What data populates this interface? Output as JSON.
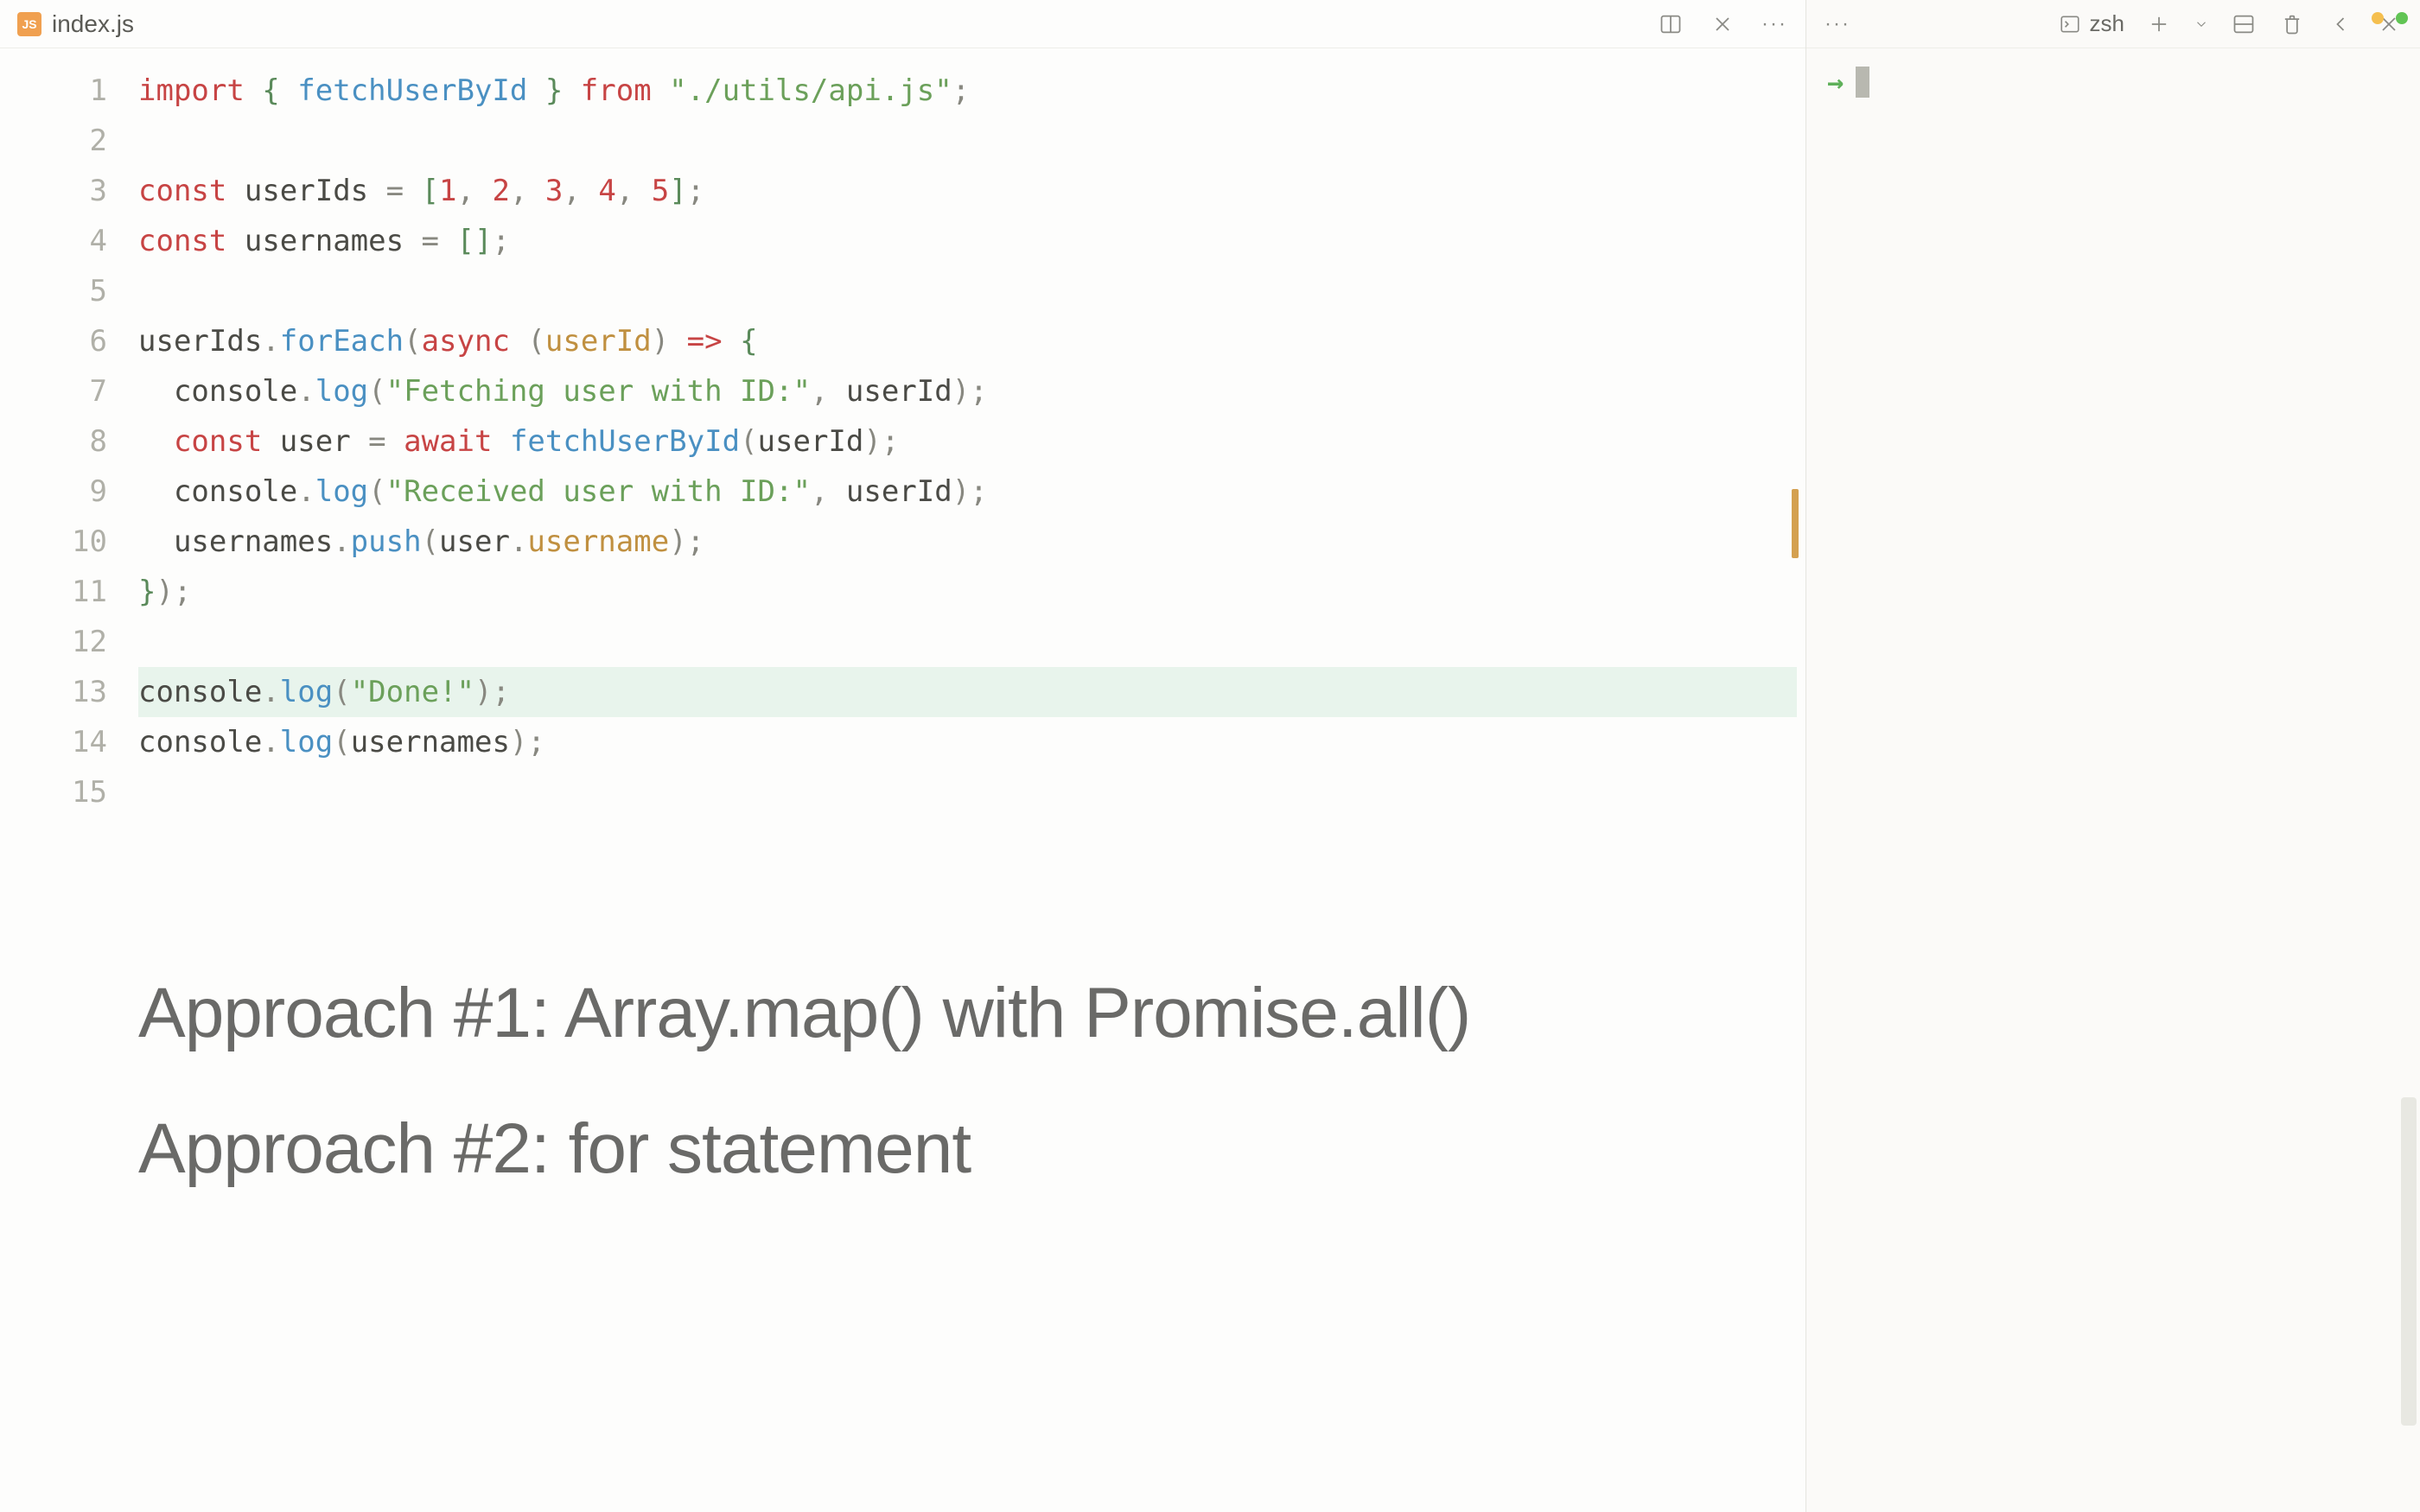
{
  "window": {
    "controls": [
      "minimize",
      "maximize"
    ]
  },
  "editor": {
    "tab": {
      "icon_label": "JS",
      "filename": "index.js"
    },
    "highlighted_line": 13,
    "line_count": 15,
    "code": {
      "l1": {
        "import_kw": "import",
        "brace_open": " { ",
        "fn": "fetchUserById",
        "brace_close": " } ",
        "from_kw": "from",
        "space": " ",
        "path": "\"./utils/api.js\"",
        "semi": ";"
      },
      "l3": {
        "const_kw": "const",
        "sp": " ",
        "name": "userIds",
        "eq": " = ",
        "bracket_open": "[",
        "n1": "1",
        "c1": ", ",
        "n2": "2",
        "c2": ", ",
        "n3": "3",
        "c3": ", ",
        "n4": "4",
        "c4": ", ",
        "n5": "5",
        "bracket_close": "]",
        "semi": ";"
      },
      "l4": {
        "const_kw": "const",
        "sp": " ",
        "name": "usernames",
        "eq": " = ",
        "brackets": "[]",
        "semi": ";"
      },
      "l6": {
        "ident": "userIds",
        "dot": ".",
        "method": "forEach",
        "paren": "(",
        "async_kw": "async ",
        "paren2": "(",
        "param": "userId",
        "paren3": ") ",
        "arrow": "=> ",
        "brace": "{"
      },
      "l7": {
        "indent": "  ",
        "ident": "console",
        "dot": ".",
        "method": "log",
        "paren": "(",
        "str": "\"Fetching user with ID:\"",
        "comma": ", ",
        "arg": "userId",
        "paren2": ")",
        "semi": ";"
      },
      "l8": {
        "indent": "  ",
        "const_kw": "const",
        "sp": " ",
        "name": "user",
        "eq": " = ",
        "await_kw": "await",
        "sp2": " ",
        "fn": "fetchUserById",
        "paren": "(",
        "arg": "userId",
        "paren2": ")",
        "semi": ";"
      },
      "l9": {
        "indent": "  ",
        "ident": "console",
        "dot": ".",
        "method": "log",
        "paren": "(",
        "str": "\"Received user with ID:\"",
        "comma": ", ",
        "arg": "userId",
        "paren2": ")",
        "semi": ";"
      },
      "l10": {
        "indent": "  ",
        "ident": "usernames",
        "dot": ".",
        "method": "push",
        "paren": "(",
        "obj": "user",
        "dot2": ".",
        "prop": "username",
        "paren2": ")",
        "semi": ";"
      },
      "l11": {
        "brace": "}",
        "paren": ")",
        "semi": ";"
      },
      "l13": {
        "ident": "console",
        "dot": ".",
        "method": "log",
        "paren": "(",
        "str": "\"Done!\"",
        "paren2": ")",
        "semi": ";"
      },
      "l14": {
        "ident": "console",
        "dot": ".",
        "method": "log",
        "paren": "(",
        "arg": "usernames",
        "paren2": ")",
        "semi": ";"
      }
    }
  },
  "approaches": {
    "line1": "Approach #1: Array.map() with Promise.all()",
    "line2": "Approach #2: for statement"
  },
  "terminal": {
    "shell_name": "zsh",
    "prompt_symbol": "→"
  },
  "line_numbers": [
    "1",
    "2",
    "3",
    "4",
    "5",
    "6",
    "7",
    "8",
    "9",
    "10",
    "11",
    "12",
    "13",
    "14",
    "15"
  ]
}
